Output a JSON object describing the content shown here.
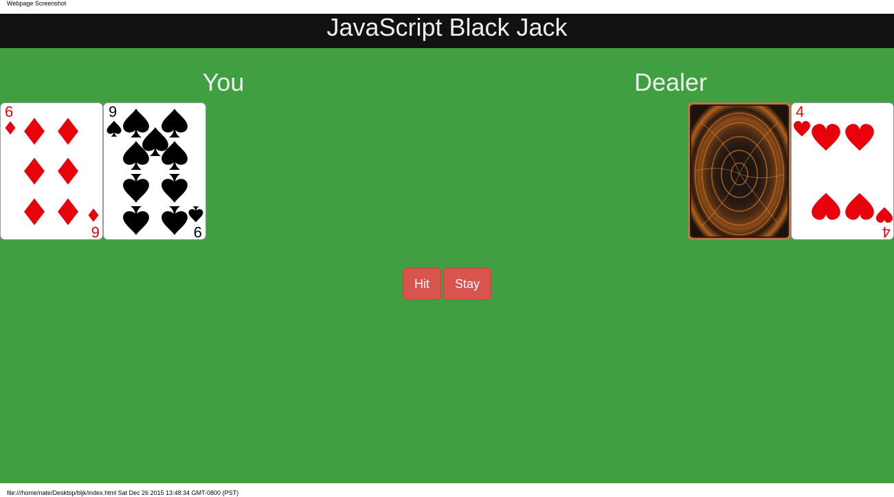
{
  "print_header": "Webpage Screenshot",
  "print_footer": "file:///home/nate/Desktop/bljk/index.html Sat Dec 26 2015 13:48:34 GMT-0800 (PST)",
  "title": "JavaScript Black Jack",
  "colors": {
    "table": "#409f41",
    "title_bar": "#111111",
    "button": "#d9534f",
    "red_suit": "#e8000b",
    "black_suit": "#000000"
  },
  "player": {
    "label": "You",
    "cards": [
      {
        "rank": "6",
        "suit": "diamonds",
        "face_up": true
      },
      {
        "rank": "9",
        "suit": "spades",
        "face_up": true
      }
    ]
  },
  "dealer": {
    "label": "Dealer",
    "cards": [
      {
        "rank": "",
        "suit": "",
        "face_up": false
      },
      {
        "rank": "4",
        "suit": "hearts",
        "face_up": true
      }
    ]
  },
  "controls": {
    "hit_label": "Hit",
    "stay_label": "Stay"
  }
}
